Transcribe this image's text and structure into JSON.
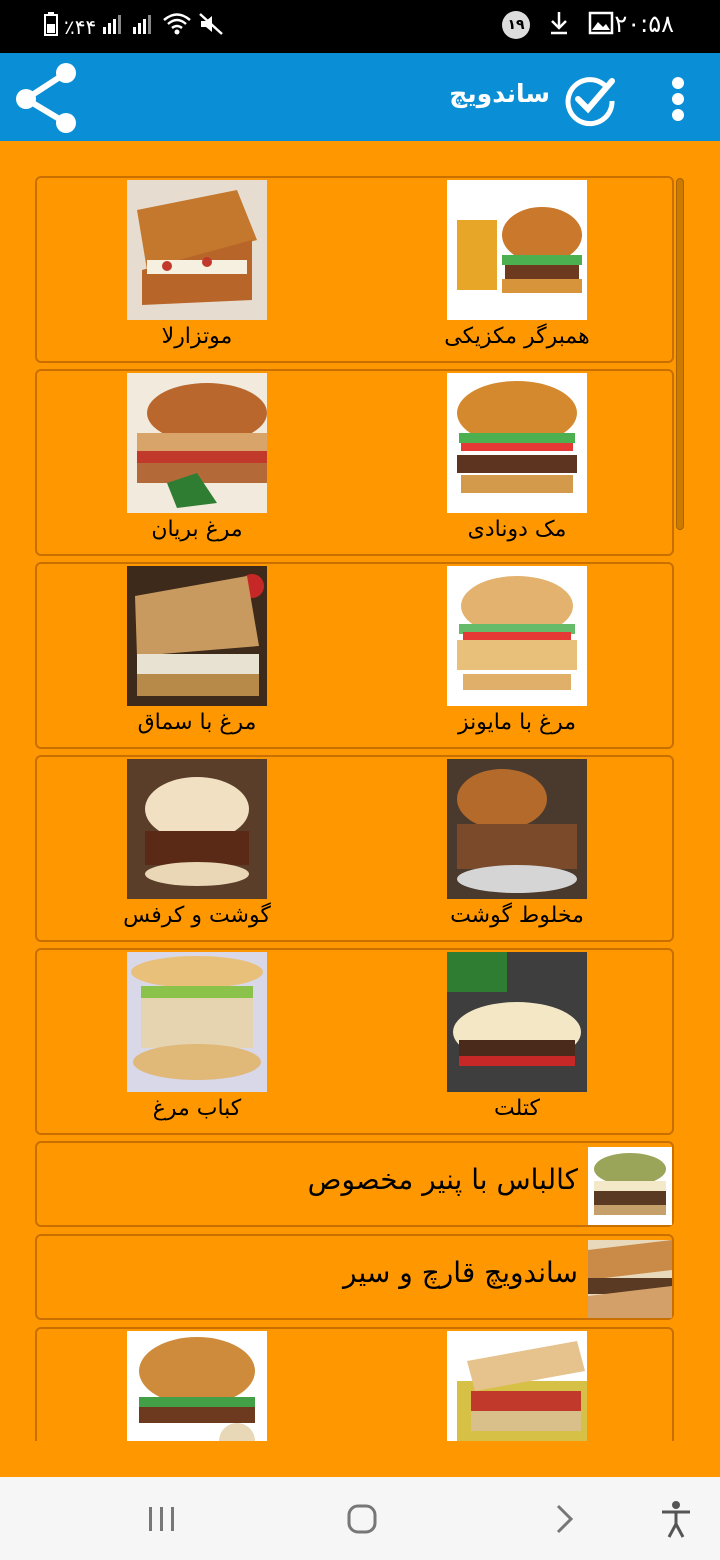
{
  "status_bar": {
    "time": "۲۰:۵۸",
    "battery": "٪۴۴",
    "notification_count": "۱۹"
  },
  "app_bar": {
    "title": "ساندویچ"
  },
  "grid_rows": [
    {
      "right": {
        "label": "همبرگر مکزیکی",
        "image": "mexican-burger"
      },
      "left": {
        "label": "موتزارلا",
        "image": "mozzarella-sandwich"
      }
    },
    {
      "right": {
        "label": "مک دونادی",
        "image": "mcdonalds-burger"
      },
      "left": {
        "label": "مرغ بریان",
        "image": "roast-chicken-sandwich"
      }
    },
    {
      "right": {
        "label": "مرغ با مایونز",
        "image": "chicken-mayo-burger"
      },
      "left": {
        "label": "مرغ با سماق",
        "image": "chicken-sumac-sandwich"
      }
    },
    {
      "right": {
        "label": "مخلوط گوشت",
        "image": "mixed-meat-sandwich"
      },
      "left": {
        "label": "گوشت و کرفس",
        "image": "meat-celery-sandwich"
      }
    },
    {
      "right": {
        "label": "کتلت",
        "image": "cutlet-sandwich"
      },
      "left": {
        "label": "کباب مرغ",
        "image": "chicken-kebab-sandwich"
      }
    }
  ],
  "single_rows": [
    {
      "label": "کالباس با پنیر مخصوص",
      "image": "bologna-cheese-sandwich"
    },
    {
      "label": "ساندویچ قارچ و سیر",
      "image": "mushroom-garlic-sandwich"
    }
  ],
  "partial_row": {
    "right": {
      "label": "",
      "image": "sub-sandwich"
    },
    "left": {
      "label": "",
      "image": "mushroom-burger"
    }
  },
  "colors": {
    "app_bar": "#0a8ed6",
    "background": "#ff9800",
    "card_border": "#c86f00"
  }
}
